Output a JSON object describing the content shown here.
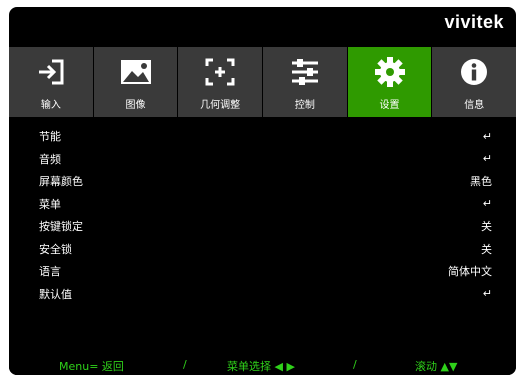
{
  "brand": "vivitek",
  "tabs": [
    {
      "label": "输入",
      "icon": "input-icon",
      "active": false
    },
    {
      "label": "图像",
      "icon": "image-icon",
      "active": false
    },
    {
      "label": "几何调整",
      "icon": "geometry-icon",
      "active": false
    },
    {
      "label": "控制",
      "icon": "sliders-icon",
      "active": false
    },
    {
      "label": "设置",
      "icon": "gear-icon",
      "active": true
    },
    {
      "label": "信息",
      "icon": "info-icon",
      "active": false
    }
  ],
  "menu": [
    {
      "label": "节能",
      "value": "↵"
    },
    {
      "label": "音频",
      "value": "↵"
    },
    {
      "label": "屏幕颜色",
      "value": "黑色"
    },
    {
      "label": "菜单",
      "value": "↵"
    },
    {
      "label": "按键锁定",
      "value": "关"
    },
    {
      "label": "安全锁",
      "value": "关"
    },
    {
      "label": "语言",
      "value": "简体中文"
    },
    {
      "label": "默认值",
      "value": "↵"
    }
  ],
  "footer": {
    "menu_back": "Menu= 返回",
    "sep1": "/",
    "menu_select": "菜单选择 ◀ ▶",
    "sep2": "/",
    "scroll": "滚动 ▲▼"
  },
  "colors": {
    "active_tab": "#2f9a00",
    "tab_bg": "#3a3a3a",
    "footer_text": "#2fd11a"
  }
}
